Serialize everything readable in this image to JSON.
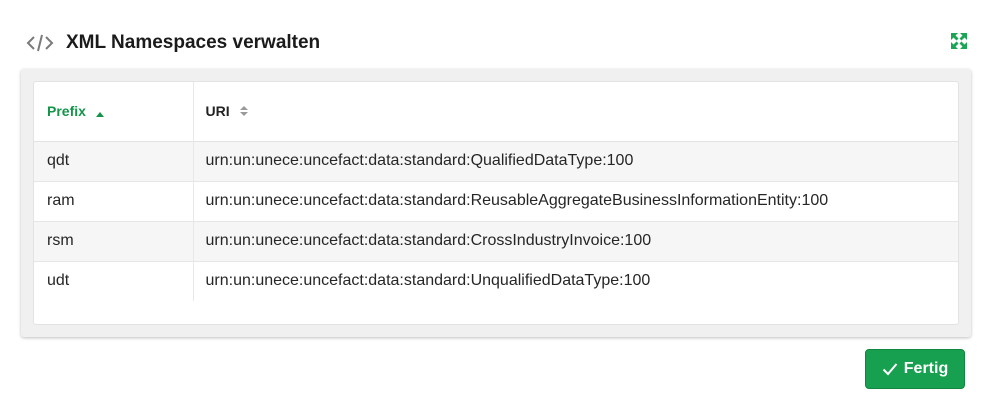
{
  "dialog": {
    "title": "XML Namespaces verwalten",
    "title_icon": "code-icon",
    "expand_icon": "expand-icon"
  },
  "table": {
    "columns": [
      {
        "label": "Prefix",
        "sort": "ascending"
      },
      {
        "label": "URI",
        "sort": "none"
      }
    ],
    "rows": [
      {
        "prefix": "qdt",
        "uri": "urn:un:unece:uncefact:data:standard:QualifiedDataType:100"
      },
      {
        "prefix": "ram",
        "uri": "urn:un:unece:uncefact:data:standard:ReusableAggregateBusinessInformationEntity:100"
      },
      {
        "prefix": "rsm",
        "uri": "urn:un:unece:uncefact:data:standard:CrossIndustryInvoice:100"
      },
      {
        "prefix": "udt",
        "uri": "urn:un:unece:uncefact:data:standard:UnqualifiedDataType:100"
      }
    ]
  },
  "footer": {
    "done_label": "Fertig",
    "done_icon": "check-icon"
  },
  "colors": {
    "accent": "#14934a",
    "button": "#17a04f"
  }
}
